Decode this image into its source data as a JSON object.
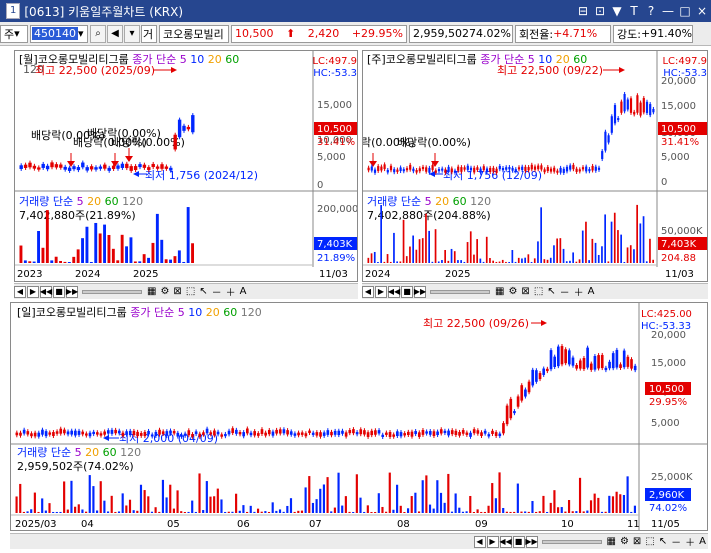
{
  "window": {
    "number": "1",
    "code": "[0613]",
    "title": "키움일주월차트 (KRX)",
    "buttons": [
      "⊟",
      "⊡",
      "▼",
      "T",
      "?",
      "—",
      "□",
      "×"
    ]
  },
  "toolbar": {
    "market": "주",
    "code": "450140",
    "kind": "거",
    "name": "코오롱모빌리",
    "price": "10,500",
    "change": "2,420",
    "rate": "+29.95%",
    "volume": "2,959,502",
    "vol_ratio": "74.02%",
    "turnover_label": "회전율:",
    "turnover": "+4.71%",
    "strength_label": "강도:",
    "strength": "+91.40%"
  },
  "charts": {
    "monthly": {
      "period": "[월]",
      "name": "코오롱모빌리티그룹",
      "ma_label": "종가 단순",
      "ma": [
        "5",
        "10",
        "20",
        "60"
      ],
      "hi": "최고 22,500 (2025/09)",
      "lo": "최저 1,756 (2024/12)",
      "lc": "LC:497.9",
      "hc": "HC:-53.3",
      "price": "10,500",
      "pct": "31.41%",
      "yticks": [
        "15,000",
        "10,000",
        "5,000",
        "0"
      ],
      "ytop": "120",
      "div": [
        "배당락(0.00%)",
        "배당락(0.00%)",
        "배당락(0.00%)",
        "배당락(0.00%)"
      ],
      "vol_label": "거래량 단순",
      "vol_ma": [
        "5",
        "20",
        "60",
        "120"
      ],
      "vol_val": "7,402,880주(21.89%)",
      "vol_ticks": [
        "200,000"
      ],
      "vol_price": "7,403K",
      "vol_pct": "21.89%",
      "dates": [
        "2023",
        "2024",
        "2025",
        "11/03"
      ]
    },
    "weekly": {
      "period": "[주]",
      "name": "코오롱모빌리티그룹",
      "ma_label": "종가 단순",
      "ma": [
        "5",
        "10",
        "20",
        "60"
      ],
      "hi": "최고 22,500 (09/22)",
      "lo": "최저 1,756 (12/09)",
      "lc": "LC:497.9",
      "hc": "HC:-53.3",
      "price": "10,500",
      "pct": "31.41%",
      "yticks": [
        "20,000",
        "15,000",
        "10,000",
        "5,000",
        "0"
      ],
      "div": [
        "락(0.00%)",
        "배당락(0.00%)"
      ],
      "vol_label": "거래량 단순",
      "vol_ma": [
        "5",
        "20",
        "60",
        "120"
      ],
      "vol_val": "7,402,880주(204.88%)",
      "vol_ticks": [
        "50,000K"
      ],
      "vol_price": "7,403K",
      "vol_pct": "204.88",
      "dates": [
        "2024",
        "2025",
        "11/03"
      ]
    },
    "daily": {
      "period": "[일]",
      "name": "코오롱모빌리티그룹",
      "ma_label": "종가 단순",
      "ma": [
        "5",
        "10",
        "20",
        "60",
        "120"
      ],
      "hi": "최고 22,500 (09/26)",
      "lo": "최저 2,000 (04/09)",
      "lc": "LC:425.00",
      "hc": "HC:-53.33",
      "price": "10,500",
      "pct": "29.95%",
      "yticks": [
        "20,000",
        "15,000",
        "10,000",
        "5,000"
      ],
      "vol_label": "거래량 단순",
      "vol_ma": [
        "5",
        "20",
        "60",
        "120"
      ],
      "vol_val": "2,959,502주(74.02%)",
      "vol_ticks": [
        "25,000K",
        "5,000K"
      ],
      "vol_price": "2,960K",
      "vol_pct": "74.02%",
      "dates": [
        "2025/03",
        "04",
        "05",
        "06",
        "07",
        "08",
        "09",
        "10",
        "11",
        "11/05"
      ]
    }
  },
  "colors": {
    "titlebar": "#26468f",
    "up": "#e30000",
    "down": "#0026ff",
    "ma5": "#9900cc",
    "ma10": "#0026ff",
    "ma20": "#f0a000",
    "ma60": "#00a000",
    "ma120": "#999999"
  }
}
